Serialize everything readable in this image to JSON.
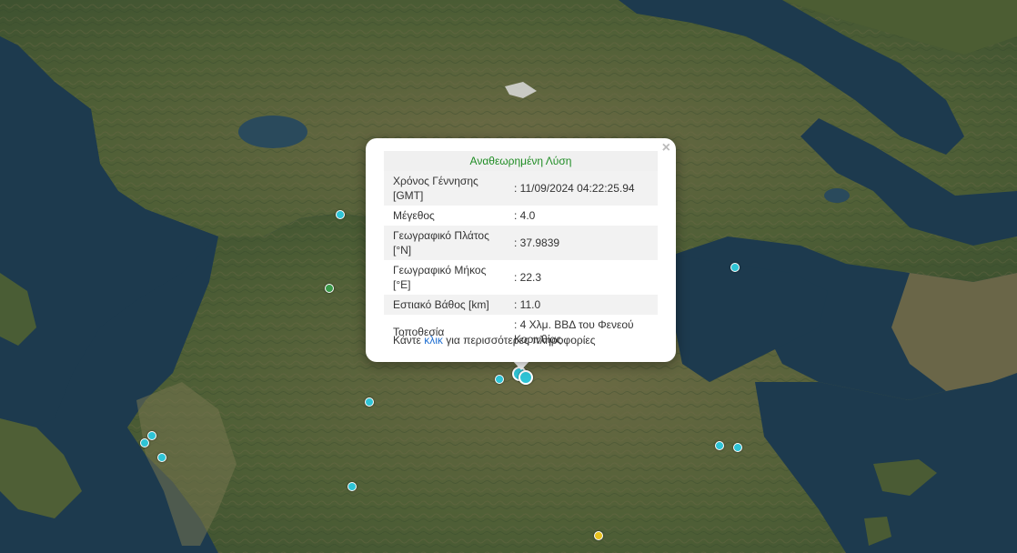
{
  "popup": {
    "title": "Αναθεωρημένη Λύση",
    "rows": [
      {
        "label": "Χρόνος Γέννησης [GMT]",
        "value": ": 11/09/2024 04:22:25.94"
      },
      {
        "label": "Μέγεθος",
        "value": ": 4.0"
      },
      {
        "label": "Γεωγραφικό Πλάτος [°N]",
        "value": ": 37.9839"
      },
      {
        "label": "Γεωγραφικό Μήκος [°E]",
        "value": ": 22.3"
      },
      {
        "label": "Εστιακό Βάθος [km]",
        "value": ": 11.0"
      },
      {
        "label": "Τοποθεσία",
        "value": ": 4 Χλμ. ΒΒΔ του Φενεού Κορινθίας"
      }
    ],
    "footer_prefix": "Κάντε ",
    "footer_link": "κλικ",
    "footer_suffix": " για περισσότερες πληροφορίες",
    "close_label": "×"
  },
  "colors": {
    "marker_cyan": "#2ec4d6",
    "marker_green": "#3a9a4a",
    "marker_yellow": "#e8c21f",
    "sea": "#1d3a4e",
    "land": "#5a6b3e"
  }
}
